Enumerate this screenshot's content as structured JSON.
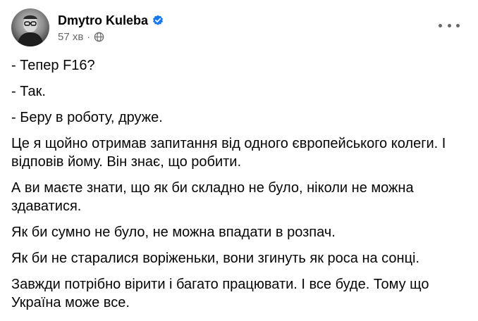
{
  "post": {
    "author": "Dmytro Kuleba",
    "timestamp": "57 хв",
    "separator": "·",
    "verified_icon": "verified-badge-icon",
    "audience_icon": "globe-icon",
    "menu_icon": "more-dots-icon",
    "accent_color": "#1877f2",
    "paragraphs": [
      "- Тепер F16?",
      "- Так.",
      "- Беру в роботу, друже.",
      "Це я щойно отримав запитання від одного європейського колеги. І відповів йому. Він знає, що робити.",
      "А ви маєте знати, що як би складно не було, ніколи не можна здаватися.",
      "Як би сумно не було, не можна впадати в розпач.",
      "Як би не старалися воріженьки, вони згинуть як роса на сонці.",
      "Завжди потрібно вірити і багато працювати. І все буде. Тому що Україна може все."
    ]
  }
}
